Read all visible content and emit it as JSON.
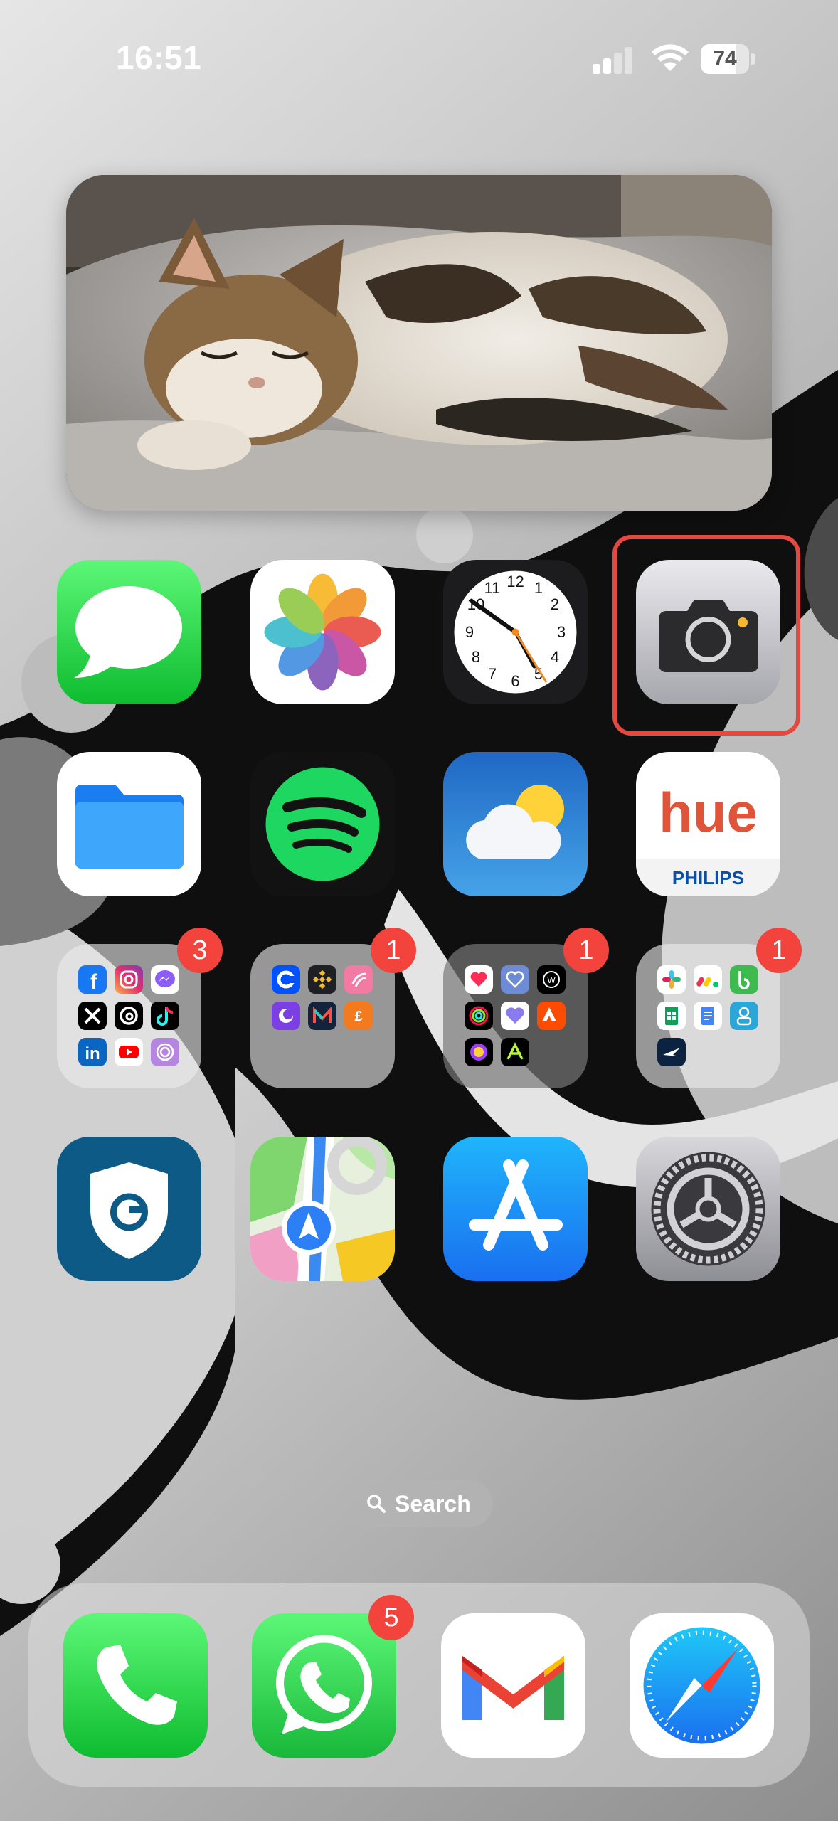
{
  "status_bar": {
    "time": "16:51",
    "battery_level": "74",
    "battery_fraction": 0.74,
    "signal_bars_active": 2,
    "signal_bars_total": 4
  },
  "widget": {
    "type": "photo",
    "subject": "sleeping-kitten"
  },
  "home_screen": {
    "row1": [
      {
        "name": "Messages",
        "icon": "messages-icon"
      },
      {
        "name": "Photos",
        "icon": "photos-icon"
      },
      {
        "name": "Clock",
        "icon": "clock-icon"
      },
      {
        "name": "Camera",
        "icon": "camera-icon",
        "highlighted": true
      }
    ],
    "row2": [
      {
        "name": "Files",
        "icon": "files-icon"
      },
      {
        "name": "Spotify",
        "icon": "spotify-icon"
      },
      {
        "name": "Weather",
        "icon": "weather-icon"
      },
      {
        "name": "Hue",
        "icon": "hue-icon",
        "text_main": "hue",
        "text_brand": "PHILIPS"
      }
    ],
    "folders": [
      {
        "badge": "3",
        "apps": [
          "facebook",
          "instagram",
          "messenger",
          "x",
          "threads",
          "tiktok",
          "linkedin",
          "youtube",
          "fingerprint"
        ]
      },
      {
        "badge": "1",
        "apps": [
          "coinbase",
          "binance",
          "zapper",
          "shazam-like",
          "monzo",
          "emoney"
        ],
        "mini_text": "£"
      },
      {
        "badge": "1",
        "apps": [
          "health",
          "fitness-heart",
          "watch",
          "activity",
          "heart",
          "strava",
          "rings",
          "runner"
        ]
      },
      {
        "badge": "1",
        "apps": [
          "slack",
          "monday",
          "bookshelf",
          "sheets",
          "docs",
          "contacts",
          "flights"
        ]
      }
    ],
    "row4": [
      {
        "name": "Security",
        "icon": "shield-icon"
      },
      {
        "name": "Maps",
        "icon": "maps-icon"
      },
      {
        "name": "App Store",
        "icon": "app-store-icon"
      },
      {
        "name": "Settings",
        "icon": "settings-icon"
      }
    ]
  },
  "search": {
    "label": "Search"
  },
  "dock": [
    {
      "name": "Phone",
      "icon": "phone-icon"
    },
    {
      "name": "WhatsApp",
      "icon": "whatsapp-icon",
      "badge": "5"
    },
    {
      "name": "Gmail",
      "icon": "gmail-icon"
    },
    {
      "name": "Safari",
      "icon": "safari-icon"
    }
  ],
  "colors": {
    "badge": "#f2433c",
    "highlight": "#e5483e",
    "messages_green": "#34c759",
    "app_store_blue": "#1a8cf5"
  }
}
